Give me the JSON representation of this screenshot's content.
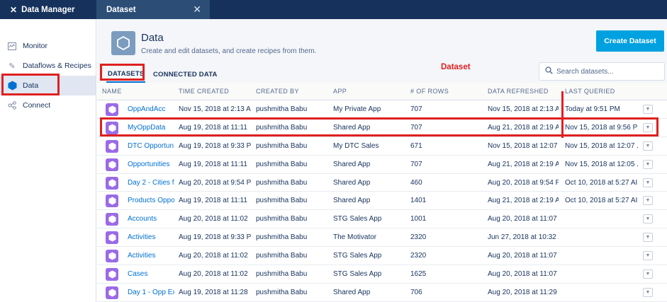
{
  "topbar": {
    "app_name": "Data Manager",
    "tab_label": "Dataset",
    "close_glyph": "✕"
  },
  "sidebar": {
    "items": [
      {
        "label": "Monitor",
        "icon": "monitor-icon",
        "active": false
      },
      {
        "label": "Dataflows & Recipes",
        "icon": "pencil-icon",
        "active": false
      },
      {
        "label": "Data",
        "icon": "hexagon-icon",
        "active": true
      },
      {
        "label": "Connect",
        "icon": "share-icon",
        "active": false
      }
    ]
  },
  "header": {
    "title": "Data",
    "subtitle": "Create and edit datasets, and create recipes from them.",
    "create_button": "Create Dataset"
  },
  "tabs": [
    {
      "label": "DATASETS",
      "active": true
    },
    {
      "label": "CONNECTED DATA",
      "active": false
    }
  ],
  "annotation": "Dataset",
  "search": {
    "placeholder": "Search datasets..."
  },
  "colors": {
    "nav": "#16325c",
    "accent": "#0070d2",
    "create": "#00a1e0",
    "dataset_icon": "#9b6ae8",
    "highlight": "#e02020"
  },
  "table": {
    "columns": [
      "NAME",
      "TIME CREATED",
      "CREATED BY",
      "APP",
      "# OF ROWS",
      "DATA REFRESHED",
      "LAST QUERIED"
    ],
    "rows": [
      [
        "OppAndAcc",
        "Nov 15, 2018 at 2:13 A",
        "pushmitha Babu",
        "My Private App",
        "707",
        "Nov 15, 2018 at 2:13 A",
        "Today at 9:51 PM"
      ],
      [
        "MyOppData",
        "Aug 19, 2018 at 11:11",
        "pushmitha Babu",
        "Shared App",
        "707",
        "Aug 21, 2018 at 2:19 A",
        "Nov 15, 2018 at 9:56 P"
      ],
      [
        "DTC Opportun",
        "Aug 19, 2018 at 9:33 P",
        "pushmitha Babu",
        "My DTC Sales",
        "671",
        "Nov 15, 2018 at 12:07 .",
        "Nov 15, 2018 at 12:07 ."
      ],
      [
        "Opportunities",
        "Aug 19, 2018 at 11:11",
        "pushmitha Babu",
        "Shared App",
        "707",
        "Aug 21, 2018 at 2:19 A",
        "Nov 15, 2018 at 12:05 ."
      ],
      [
        "Day 2 - Cities f",
        "Aug 20, 2018 at 9:54 P",
        "pushmitha Babu",
        "Shared App",
        "460",
        "Aug 20, 2018 at 9:54 P",
        "Oct 10, 2018 at 5:27 AI"
      ],
      [
        "Products Oppo",
        "Aug 19, 2018 at 11:11",
        "pushmitha Babu",
        "Shared App",
        "1401",
        "Aug 21, 2018 at 2:19 A",
        "Oct 10, 2018 at 5:27 AI"
      ],
      [
        "Accounts",
        "Aug 20, 2018 at 11:02",
        "pushmitha Babu",
        "STG Sales App",
        "1001",
        "Aug 20, 2018 at 11:07 I",
        ""
      ],
      [
        "Activities",
        "Aug 19, 2018 at 9:33 P",
        "pushmitha Babu",
        "The Motivator",
        "2320",
        "Jun 27, 2018 at 10:32 /",
        ""
      ],
      [
        "Activities",
        "Aug 20, 2018 at 11:02",
        "pushmitha Babu",
        "STG Sales App",
        "2320",
        "Aug 20, 2018 at 11:07 I",
        ""
      ],
      [
        "Cases",
        "Aug 20, 2018 at 11:02",
        "pushmitha Babu",
        "STG Sales App",
        "1625",
        "Aug 20, 2018 at 11:07 I",
        ""
      ],
      [
        "Day 1 - Opp Ex",
        "Aug 19, 2018 at 11:28",
        "pushmitha Babu",
        "Shared App",
        "706",
        "Aug 20, 2018 at 11:29 I",
        ""
      ]
    ],
    "highlighted_row": 1
  }
}
